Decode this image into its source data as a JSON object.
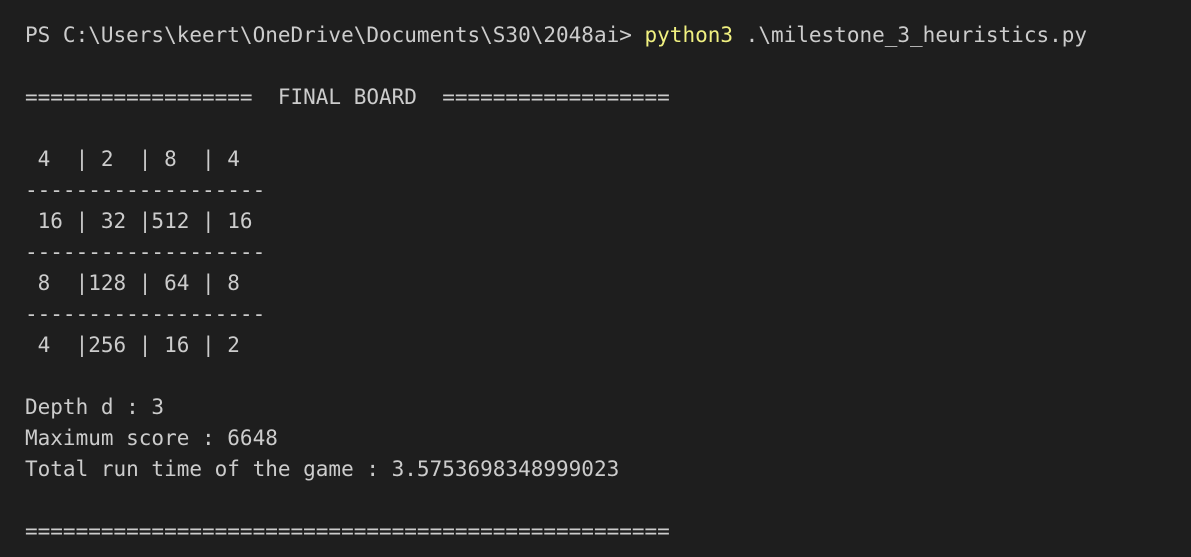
{
  "terminal": {
    "prompt": "PS C:\\Users\\keert\\OneDrive\\Documents\\S30\\2048ai> ",
    "command": "python3",
    "argument": " .\\milestone_3_heuristics.py",
    "header": "==================  FINAL BOARD  ==================",
    "board": {
      "row1": " 4  | 2  | 8  | 4",
      "sep1": "-------------------",
      "row2": " 16 | 32 |512 | 16",
      "sep2": "-------------------",
      "row3": " 8  |128 | 64 | 8",
      "sep3": "-------------------",
      "row4": " 4  |256 | 16 | 2"
    },
    "depth": "Depth d : 3",
    "max_score": "Maximum score : 6648",
    "run_time": "Total run time of the game : 3.5753698348999023",
    "footer": "==================================================="
  },
  "colors": {
    "background": "#1e1e1e",
    "text": "#cccccc",
    "command": "#f0f080"
  }
}
